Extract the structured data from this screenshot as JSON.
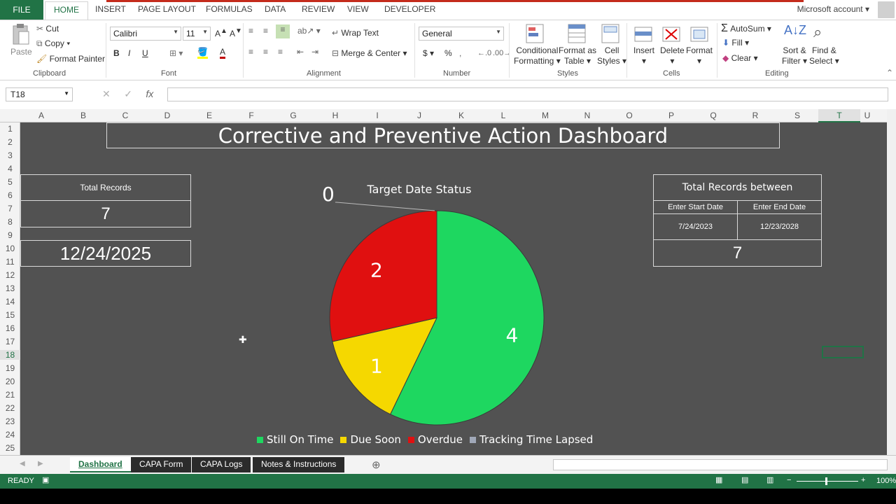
{
  "ribbon_tabs": [
    "FILE",
    "HOME",
    "INSERT",
    "PAGE LAYOUT",
    "FORMULAS",
    "DATA",
    "REVIEW",
    "VIEW",
    "DEVELOPER"
  ],
  "account_label": "Microsoft account",
  "clipboard": {
    "paste": "Paste",
    "cut": "Cut",
    "copy": "Copy",
    "format_painter": "Format Painter",
    "label": "Clipboard"
  },
  "font": {
    "name": "Calibri",
    "size": "11",
    "label": "Font",
    "bold": "B",
    "italic": "I",
    "underline": "U"
  },
  "alignment": {
    "wrap_text": "Wrap Text",
    "merge_center": "Merge & Center",
    "label": "Alignment"
  },
  "number": {
    "format": "General",
    "label": "Number",
    "currency": "$",
    "percent": "%"
  },
  "styles": {
    "conditional": "Conditional",
    "formatting": "Formatting",
    "format_as": "Format as",
    "table": "Table",
    "cell": "Cell",
    "cell_styles": "Styles",
    "label": "Styles"
  },
  "cells": {
    "insert": "Insert",
    "delete": "Delete",
    "format": "Format",
    "label": "Cells"
  },
  "editing": {
    "autosum": "AutoSum",
    "fill": "Fill",
    "clear": "Clear",
    "sort": "Sort &",
    "filter": "Filter",
    "find": "Find &",
    "select": "Select",
    "label": "Editing"
  },
  "name_box": "T18",
  "columns": [
    "A",
    "B",
    "C",
    "D",
    "E",
    "F",
    "G",
    "H",
    "I",
    "J",
    "K",
    "L",
    "M",
    "N",
    "O",
    "P",
    "Q",
    "R",
    "S",
    "T",
    "U"
  ],
  "rows": [
    "1",
    "2",
    "3",
    "4",
    "5",
    "6",
    "7",
    "8",
    "9",
    "10",
    "11",
    "12",
    "13",
    "14",
    "15",
    "16",
    "17",
    "18",
    "19",
    "20",
    "21",
    "22",
    "23",
    "24",
    "25"
  ],
  "dashboard": {
    "title": "Corrective and Preventive Action Dashboard",
    "total_records_label": "Total Records",
    "total_records_value": "7",
    "current_date": "12/24/2025",
    "range_title": "Total Records between",
    "start_label": "Enter Start Date",
    "end_label": "Enter End Date",
    "start_date": "7/24/2023",
    "end_date": "12/23/2028",
    "range_total": "7"
  },
  "chart_data": {
    "type": "pie",
    "title": "Target Date Status",
    "categories": [
      "Still On Time",
      "Due Soon",
      "Overdue",
      "Tracking Time Lapsed"
    ],
    "values": [
      4,
      1,
      2,
      0
    ],
    "colors": [
      "#1ed760",
      "#f5d800",
      "#e01010",
      "#a0a8b8"
    ],
    "legend": "bottom"
  },
  "sheet_tabs": [
    "Dashboard",
    "CAPA Form",
    "CAPA Logs",
    "Notes & Instructions"
  ],
  "status": {
    "ready": "READY",
    "zoom": "100%"
  }
}
